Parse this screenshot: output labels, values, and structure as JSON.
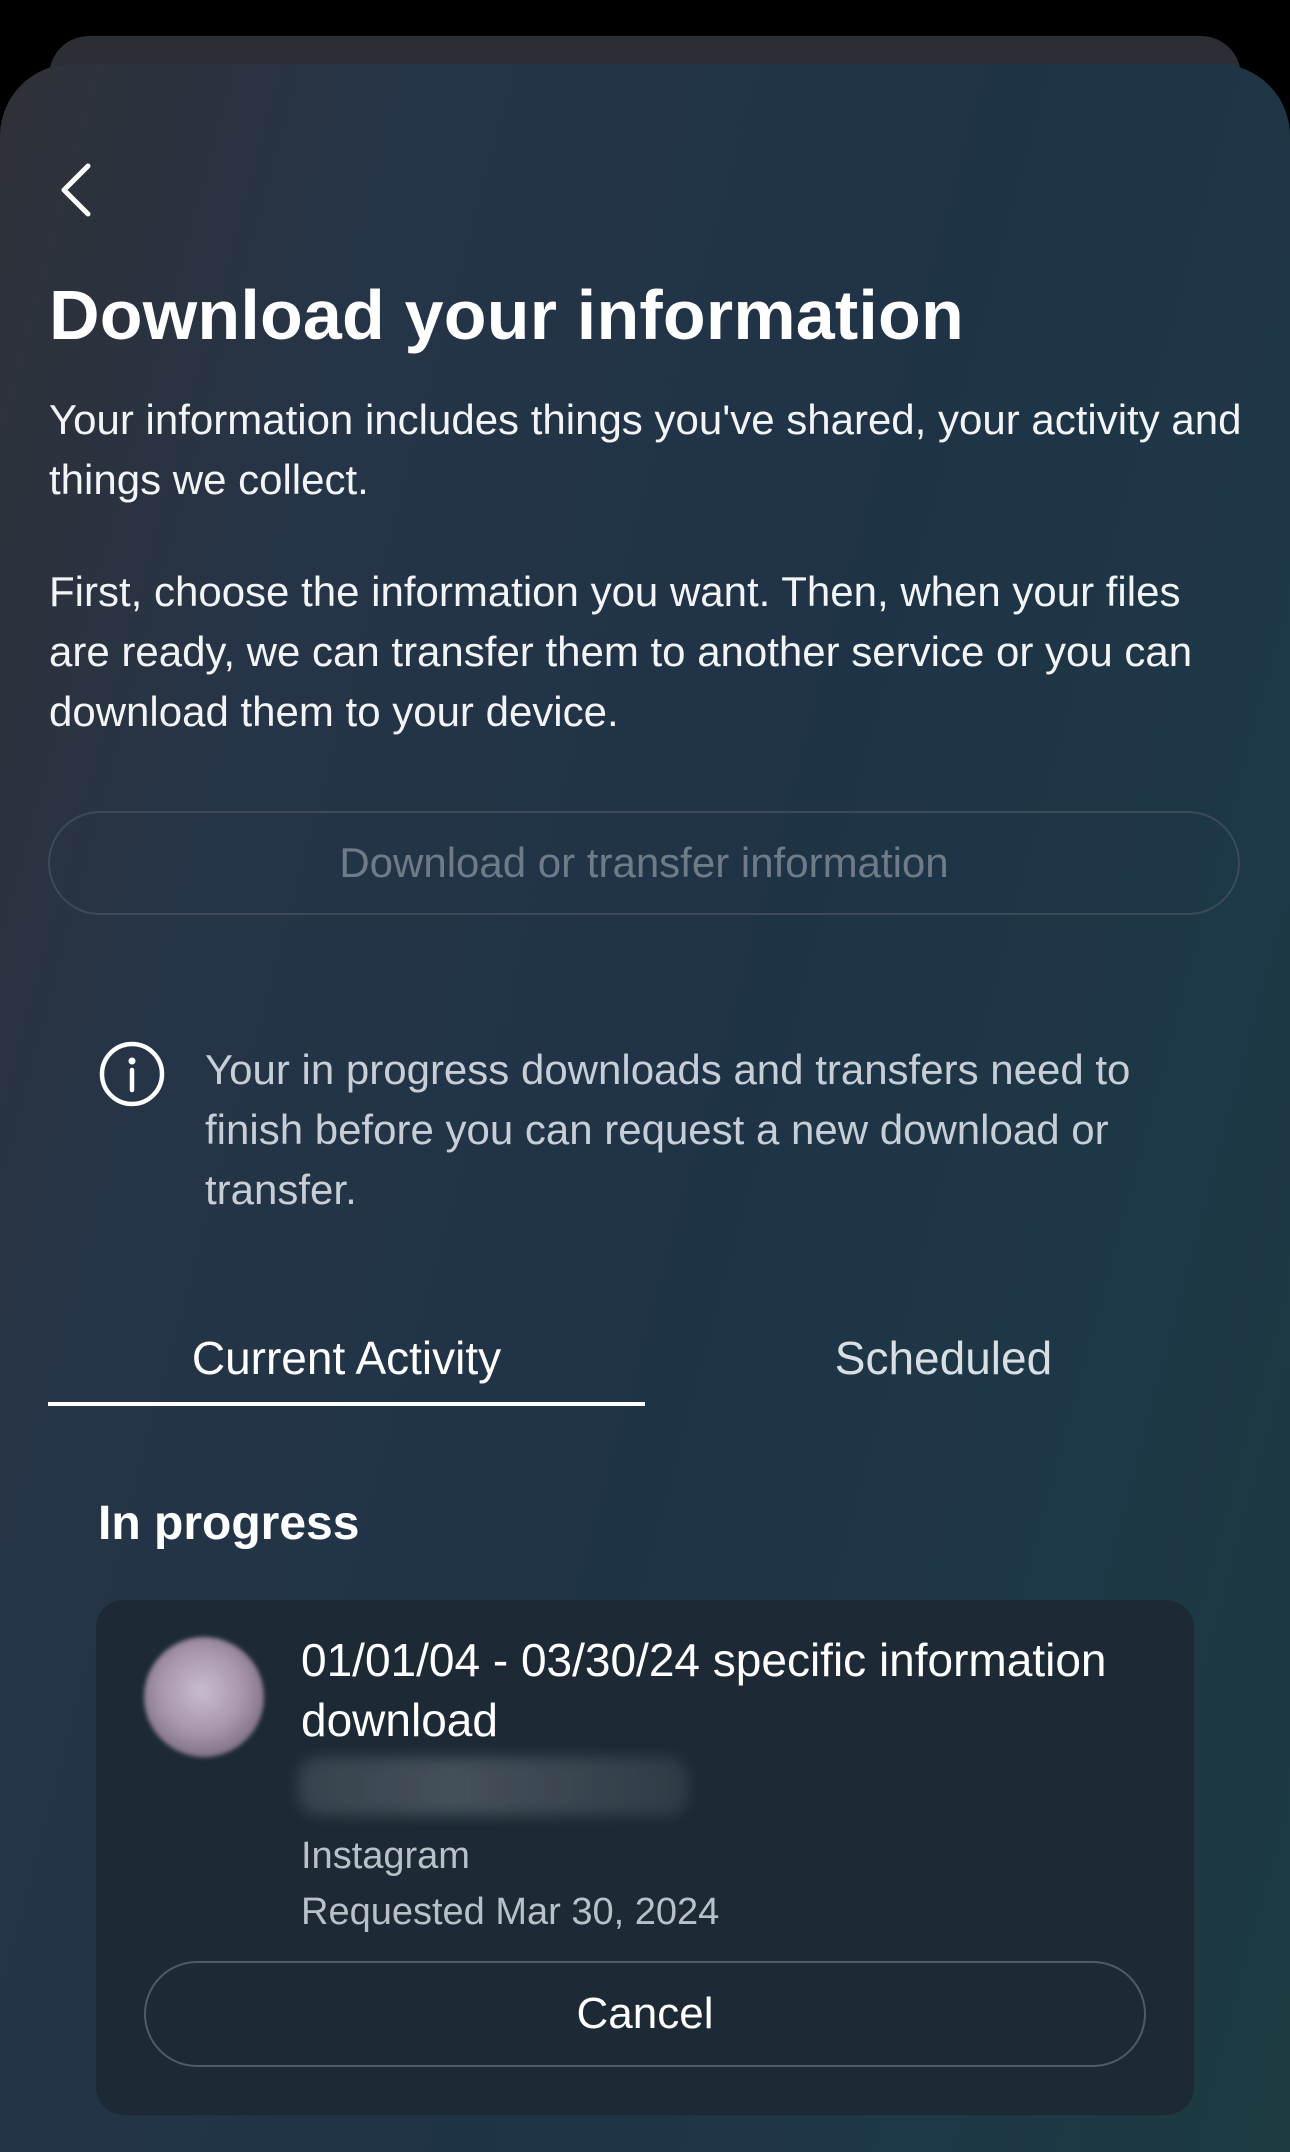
{
  "header": {
    "back_icon": "chevron-left-icon",
    "title": "Download your information"
  },
  "intro": {
    "paragraph_1": "Your information includes things you've shared, your activity and things we collect.",
    "paragraph_2": "First, choose the information you want. Then, when your files are ready, we can transfer them to another service or you can download them to your device."
  },
  "primary_button": {
    "label": "Download or transfer information",
    "state": "disabled"
  },
  "notice": {
    "icon": "info-icon",
    "text": "Your in progress downloads and transfers need to finish before you can request a new download or transfer."
  },
  "tabs": [
    {
      "label": "Current Activity",
      "selected": true
    },
    {
      "label": "Scheduled",
      "selected": false
    }
  ],
  "in_progress": {
    "heading": "In progress",
    "items": [
      {
        "title": "01/01/04 - 03/30/24 specific information download",
        "source": "Instagram",
        "requested": "Requested Mar 30, 2024",
        "cancel_label": "Cancel"
      }
    ]
  },
  "colors": {
    "background": "#1f3347",
    "text_primary": "#ffffff",
    "text_secondary": "#b8c0c8",
    "disabled_text": "#6f7c88",
    "card_background": "#1d2a35"
  }
}
